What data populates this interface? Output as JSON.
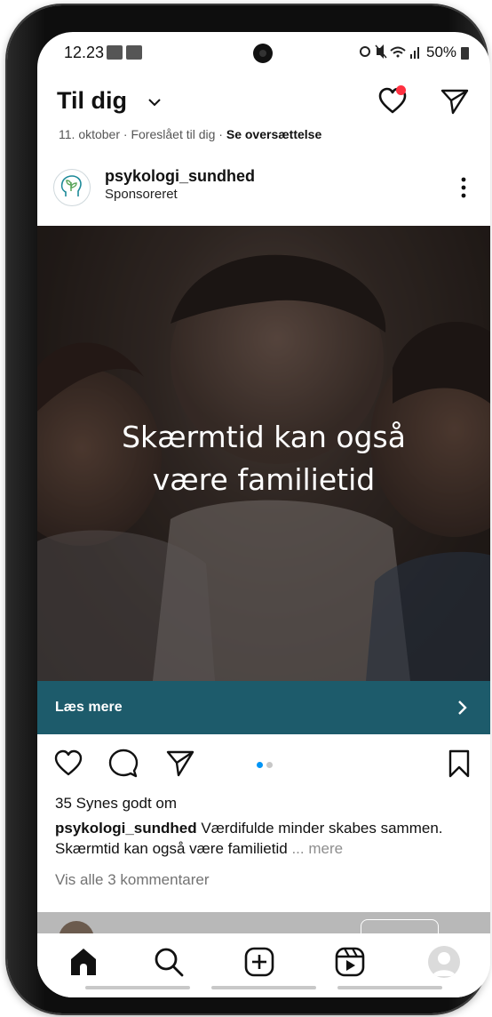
{
  "status_bar": {
    "time": "12.23",
    "battery": "50%"
  },
  "header": {
    "title": "Til dig",
    "icons": [
      "chevron-down-icon",
      "heart-icon",
      "send-icon"
    ],
    "notification_dot_color": "#ff3040"
  },
  "previous_post": {
    "meta_date": "11. oktober",
    "meta_suggested": "Foreslået til dig",
    "meta_translate": "Se oversættelse"
  },
  "post": {
    "username": "psykologi_sundhed",
    "sponsored_label": "Sponsoreret",
    "ad_headline_line1": "Skærmtid kan også",
    "ad_headline_line2": "være familietid",
    "cta_label": "Læs mere",
    "cta_color": "#1d5b6b",
    "carousel": {
      "count": 2,
      "active_index": 0,
      "active_color": "#0095f6"
    },
    "likes": "35 Synes godt om",
    "caption_username": "psykologi_sundhed",
    "caption_text": "Værdifulde minder skabes sammen. Skærmtid kan også være familietid",
    "caption_more": "... mere",
    "comments_link": "Vis alle 3 kommentarer"
  },
  "bottom_nav": {
    "items": [
      "home-icon",
      "search-icon",
      "create-icon",
      "reels-icon",
      "profile-avatar"
    ]
  }
}
